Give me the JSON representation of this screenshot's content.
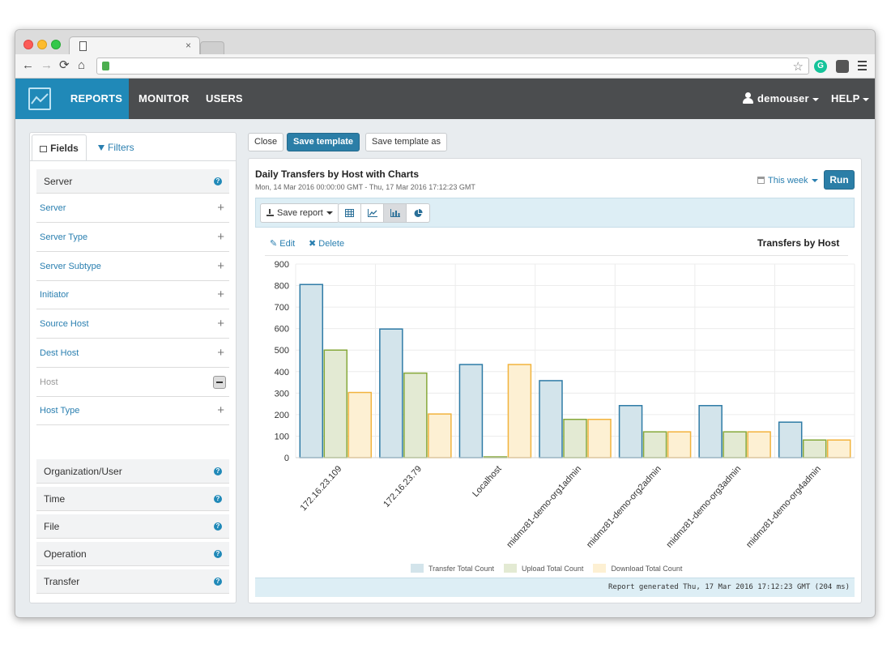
{
  "browser": {
    "nav": {
      "back": "←",
      "forward": "→",
      "reload": "⟳",
      "home": "⌂"
    }
  },
  "app": {
    "nav": [
      {
        "label": "REPORTS",
        "active": true
      },
      {
        "label": "MONITOR",
        "active": false
      },
      {
        "label": "USERS",
        "active": false
      }
    ],
    "user": "demouser",
    "help": "HELP",
    "accent": "#2089b8",
    "header_bg": "#4b4d4f"
  },
  "sidebar": {
    "tabs": {
      "fields": "Fields",
      "filters": "Filters"
    },
    "group_server": "Server",
    "fields": [
      {
        "label": "Server",
        "selected": false
      },
      {
        "label": "Server Type",
        "selected": false
      },
      {
        "label": "Server Subtype",
        "selected": false
      },
      {
        "label": "Initiator",
        "selected": false
      },
      {
        "label": "Source Host",
        "selected": false
      },
      {
        "label": "Dest Host",
        "selected": false
      },
      {
        "label": "Host",
        "selected": true
      },
      {
        "label": "Host Type",
        "selected": false
      }
    ],
    "groups": [
      "Organization/User",
      "Time",
      "File",
      "Operation",
      "Transfer"
    ]
  },
  "actions": {
    "close": "Close",
    "save_template": "Save template",
    "save_template_as": "Save template as"
  },
  "report": {
    "title": "Daily Transfers by Host with Charts",
    "subtitle": "Mon, 14 Mar 2016 00:00:00 GMT - Thu, 17 Mar 2016 17:12:23 GMT",
    "period": "This week",
    "run": "Run",
    "save_report": "Save report",
    "view_modes": [
      "table-icon",
      "line-chart-icon",
      "bar-chart-icon",
      "pie-chart-icon"
    ],
    "active_view": "bar-chart-icon",
    "edit": "Edit",
    "delete": "Delete",
    "footer": "Report generated Thu, 17 Mar 2016 17:12:23 GMT (204 ms)"
  },
  "chart_data": {
    "type": "bar",
    "title": "Transfers by Host",
    "categories": [
      "172.16.23.109",
      "172.16.23.79",
      "Localhost",
      "midmz81-demo-org1admin",
      "midmz81-demo-org2admin",
      "midmz81-demo-org3admin",
      "midmz81-demo-org4admin"
    ],
    "series": [
      {
        "name": "Transfer Total Count",
        "values": [
          805,
          598,
          433,
          358,
          242,
          242,
          165
        ],
        "fill": "#d3e4eb",
        "stroke": "#2e7ba6"
      },
      {
        "name": "Upload Total Count",
        "values": [
          500,
          393,
          0,
          178,
          120,
          120,
          82
        ],
        "fill": "#e3ead3",
        "stroke": "#86a83a"
      },
      {
        "name": "Download Total Count",
        "values": [
          303,
          203,
          433,
          178,
          120,
          120,
          82
        ],
        "fill": "#fdf0d3",
        "stroke": "#f2b33d"
      }
    ],
    "ylim": [
      0,
      900
    ],
    "yticks": [
      0,
      100,
      200,
      300,
      400,
      500,
      600,
      700,
      800,
      900
    ],
    "grid": true,
    "legend": "bottom"
  }
}
